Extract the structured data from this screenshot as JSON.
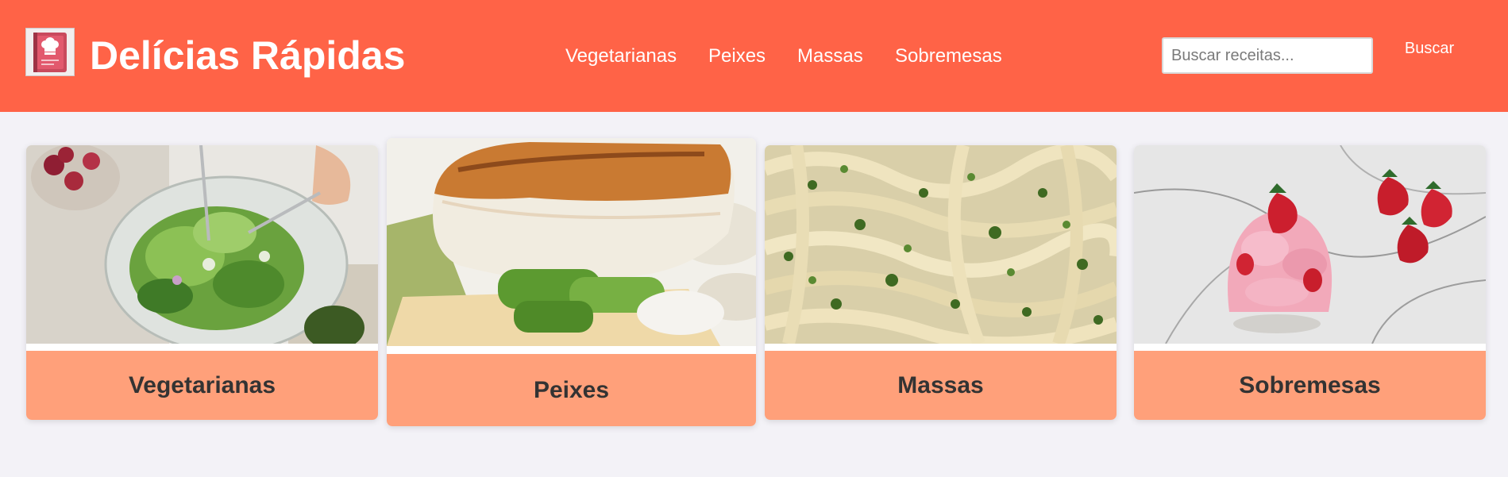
{
  "header": {
    "logo_icon": "recipe-book-icon",
    "brand_title": "Delícias Rápidas",
    "background_color": "#ff6347"
  },
  "nav": {
    "items": [
      {
        "label": "Vegetarianas"
      },
      {
        "label": "Peixes"
      },
      {
        "label": "Massas"
      },
      {
        "label": "Sobremesas"
      }
    ]
  },
  "search": {
    "placeholder": "Buscar receitas...",
    "value": "",
    "button_label": "Buscar"
  },
  "categories": [
    {
      "label": "Vegetarianas",
      "image": "salad-photo",
      "hovered": false
    },
    {
      "label": "Peixes",
      "image": "grilled-fish-photo",
      "hovered": true
    },
    {
      "label": "Massas",
      "image": "pesto-pasta-photo",
      "hovered": false
    },
    {
      "label": "Sobremesas",
      "image": "strawberry-dessert-photo",
      "hovered": false
    }
  ],
  "colors": {
    "accent": "#ff6347",
    "card_label_bg": "#ffa07a",
    "page_bg": "#f3f2f7",
    "card_label_text": "#333333"
  }
}
